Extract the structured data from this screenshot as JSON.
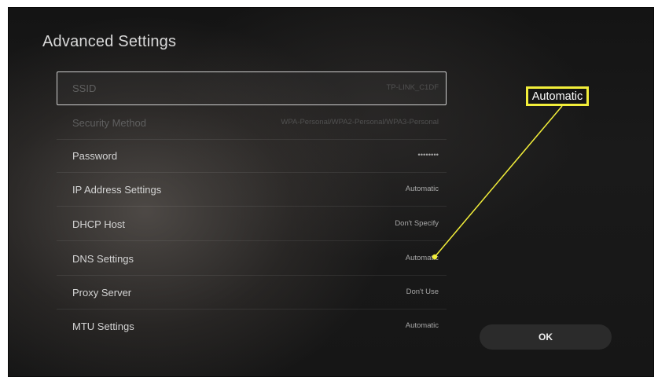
{
  "page": {
    "title": "Advanced Settings"
  },
  "settings": [
    {
      "label": "SSID",
      "value": "TP-LINK_C1DF"
    },
    {
      "label": "Security Method",
      "value": "WPA-Personal/WPA2-Personal/WPA3-Personal"
    },
    {
      "label": "Password",
      "value": "••••••••"
    },
    {
      "label": "IP Address Settings",
      "value": "Automatic"
    },
    {
      "label": "DHCP Host",
      "value": "Don't Specify"
    },
    {
      "label": "DNS Settings",
      "value": "Automatic"
    },
    {
      "label": "Proxy Server",
      "value": "Don't Use"
    },
    {
      "label": "MTU Settings",
      "value": "Automatic"
    }
  ],
  "buttons": {
    "ok_label": "OK"
  },
  "annotation": {
    "callout_text": "Automatic",
    "color": "#f2ee3a"
  }
}
